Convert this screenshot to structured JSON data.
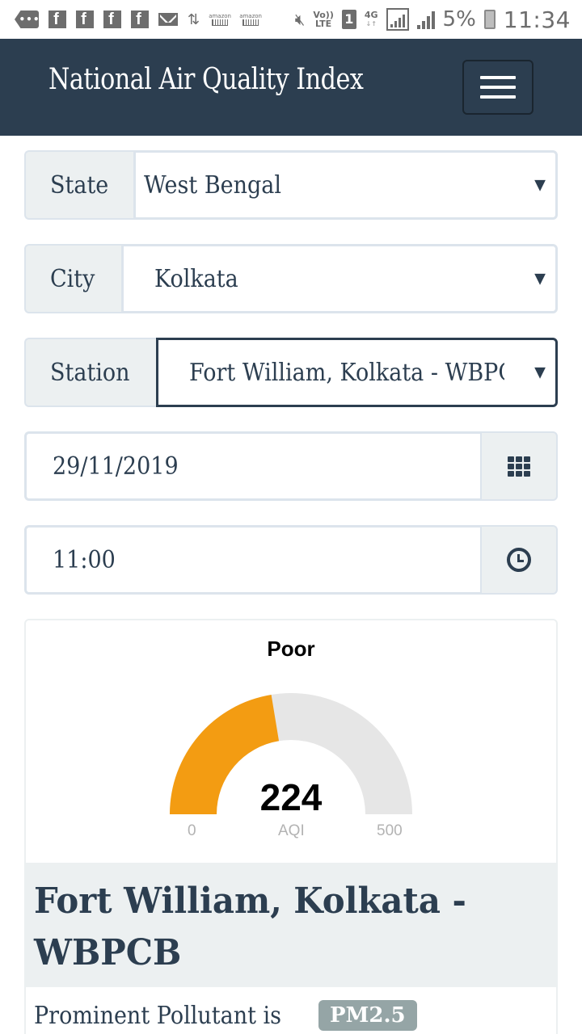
{
  "status_bar": {
    "notification_icons": [
      "more-icon",
      "facebook-icon",
      "facebook-icon",
      "facebook-icon",
      "facebook-icon",
      "mail-icon",
      "data-transfer-icon",
      "amazon-icon",
      "amazon-icon"
    ],
    "amazon_label": "amazon",
    "volte_line1": "Vo))",
    "volte_line2": "LTE",
    "sim_slot": "1",
    "network_type": "4G",
    "battery_percent": "5%",
    "time": "11:34"
  },
  "navbar": {
    "title": "National Air Quality Index",
    "menu_icon": "hamburger-icon"
  },
  "form": {
    "state": {
      "label": "State",
      "value": "West Bengal"
    },
    "city": {
      "label": "City",
      "value": "Kolkata"
    },
    "station": {
      "label": "Station",
      "value": "Fort William, Kolkata - WBPCB"
    },
    "date": {
      "value": "29/11/2019",
      "icon": "calendar-grid-icon"
    },
    "time": {
      "value": "11:00",
      "icon": "clock-icon"
    },
    "caret": "▼"
  },
  "gauge": {
    "category": "Poor",
    "value": 224,
    "value_label": "224",
    "min": 0,
    "max": 500,
    "min_label": "0",
    "max_label": "500",
    "unit_label": "AQI",
    "fill_color": "#f39c12",
    "track_color": "#e6e6e6"
  },
  "station_card": {
    "name": "Fort William, Kolkata - WBPCB",
    "pollutant_text": "Prominent Pollutant is",
    "pollutant": "PM2.5"
  },
  "colors": {
    "navbar_bg": "#2c3e50",
    "addon_bg": "#ecf0f1",
    "badge_bg": "#95a5a6"
  }
}
